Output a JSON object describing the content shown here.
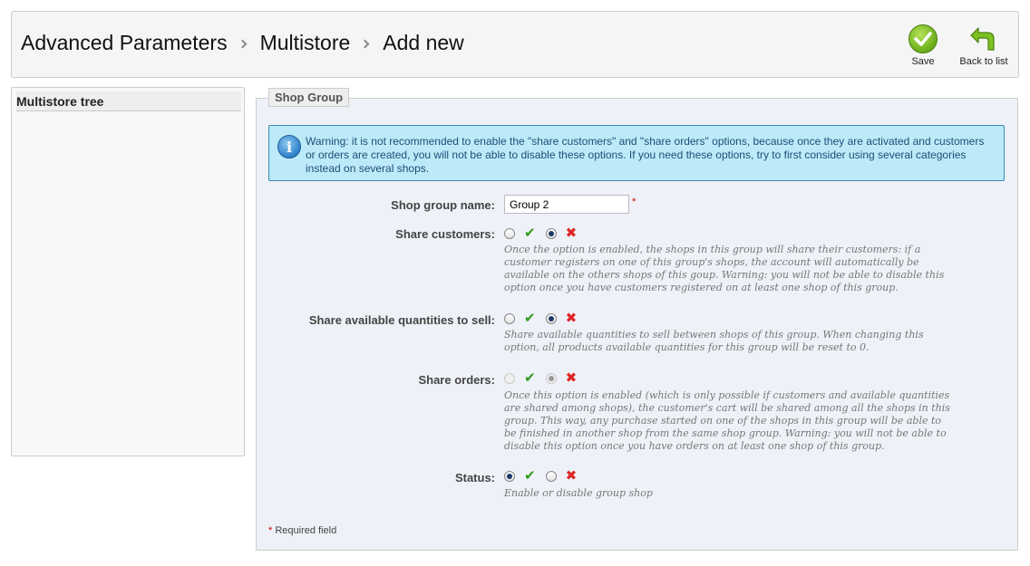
{
  "breadcrumb": [
    "Advanced Parameters",
    "Multistore",
    "Add new"
  ],
  "toolbar": {
    "save_label": "Save",
    "back_label": "Back to list"
  },
  "tree": {
    "title": "Multistore tree"
  },
  "form": {
    "legend": "Shop Group",
    "warning": "Warning: it is not recommended to enable the \"share customers\" and \"share orders\" options, because once they are activated and customers or orders are created, you will not be able to disable these options. If you need these options, try to first consider using several categories instead on several shops.",
    "name_label": "Shop group name:",
    "name_value": "Group 2",
    "required_star": "*",
    "share_customers": {
      "label": "Share customers:",
      "help": "Once the option is enabled, the shops in this group will share their customers: if a customer registers on one of this group's shops, the account will automatically be available on the others shops of this goup. Warning: you will not be able to disable this option once you have customers registered on at least one shop of this group.",
      "selected": "no"
    },
    "share_stock": {
      "label": "Share available quantities to sell:",
      "help": "Share available quantities to sell between shops of this group. When changing this option, all products available quantities for this group will be reset to 0.",
      "selected": "no"
    },
    "share_orders": {
      "label": "Share orders:",
      "help": "Once this option is enabled (which is only possible if customers and available quantities are shared among shops), the customer's cart will be shared among all the shops in this group. This way, any purchase started on one of the shops in this group will be able to be finished in another shop from the same shop group. Warning: you will not be able to disable this option once you have orders on at least one shop of this group.",
      "selected": "no",
      "disabled": true
    },
    "status": {
      "label": "Status:",
      "help": "Enable or disable group shop",
      "selected": "yes"
    },
    "required_note": "Required field"
  },
  "icons": {
    "save": "check-circle-icon",
    "back": "back-arrow-icon",
    "info": "info-icon",
    "yes": "check-icon",
    "no": "cross-icon"
  },
  "colors": {
    "accent_green": "#6aad1a",
    "info_bg": "#bdeaf8",
    "error_red": "#e02424"
  }
}
